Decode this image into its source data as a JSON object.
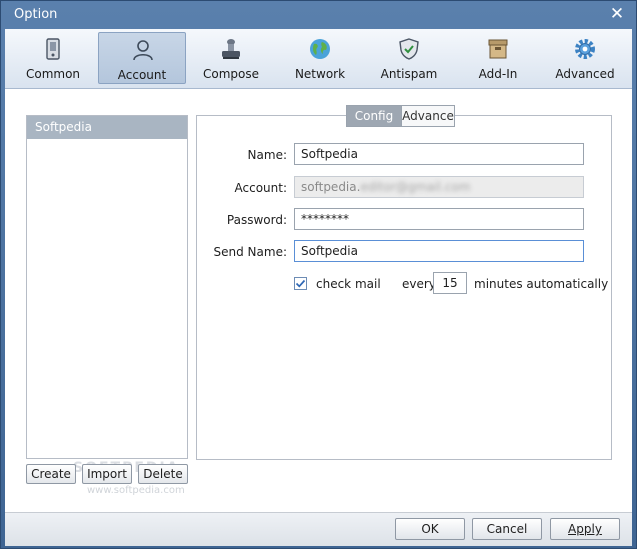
{
  "window": {
    "title": "Option"
  },
  "toolbar": {
    "items": [
      {
        "label": "Common",
        "icon": "device-icon"
      },
      {
        "label": "Account",
        "icon": "user-icon"
      },
      {
        "label": "Compose",
        "icon": "stamp-icon"
      },
      {
        "label": "Network",
        "icon": "globe-icon"
      },
      {
        "label": "Antispam",
        "icon": "shield-icon"
      },
      {
        "label": "Add-In",
        "icon": "box-icon"
      },
      {
        "label": "Advanced",
        "icon": "gear-icon"
      }
    ],
    "active": "Account"
  },
  "accounts": {
    "items": [
      "Softpedia"
    ]
  },
  "left_buttons": {
    "create": "Create",
    "import": "Import",
    "delete": "Delete"
  },
  "watermark": {
    "text": "SOFTPEDIA",
    "url": "www.softpedia.com"
  },
  "tabs": {
    "config": "Config",
    "advance": "Advance"
  },
  "form": {
    "name_label": "Name:",
    "name_value": "Softpedia",
    "account_label": "Account:",
    "account_value": "softpedia.",
    "account_blurred": "editor@gmail.com",
    "password_label": "Password:",
    "password_value": "********",
    "send_name_label": "Send Name:",
    "send_name_value": "Softpedia",
    "check_mail_label": "check mail",
    "check_mail_checked": true,
    "every_label": "every",
    "minutes_value": "15",
    "minutes_label": "minutes automatically"
  },
  "footer": {
    "ok": "OK",
    "cancel": "Cancel",
    "apply": "Apply"
  },
  "colors": {
    "title_bar": "#4a6f9d",
    "active_tool": "#b9cadf",
    "selected_item": "#a9b5c2"
  }
}
